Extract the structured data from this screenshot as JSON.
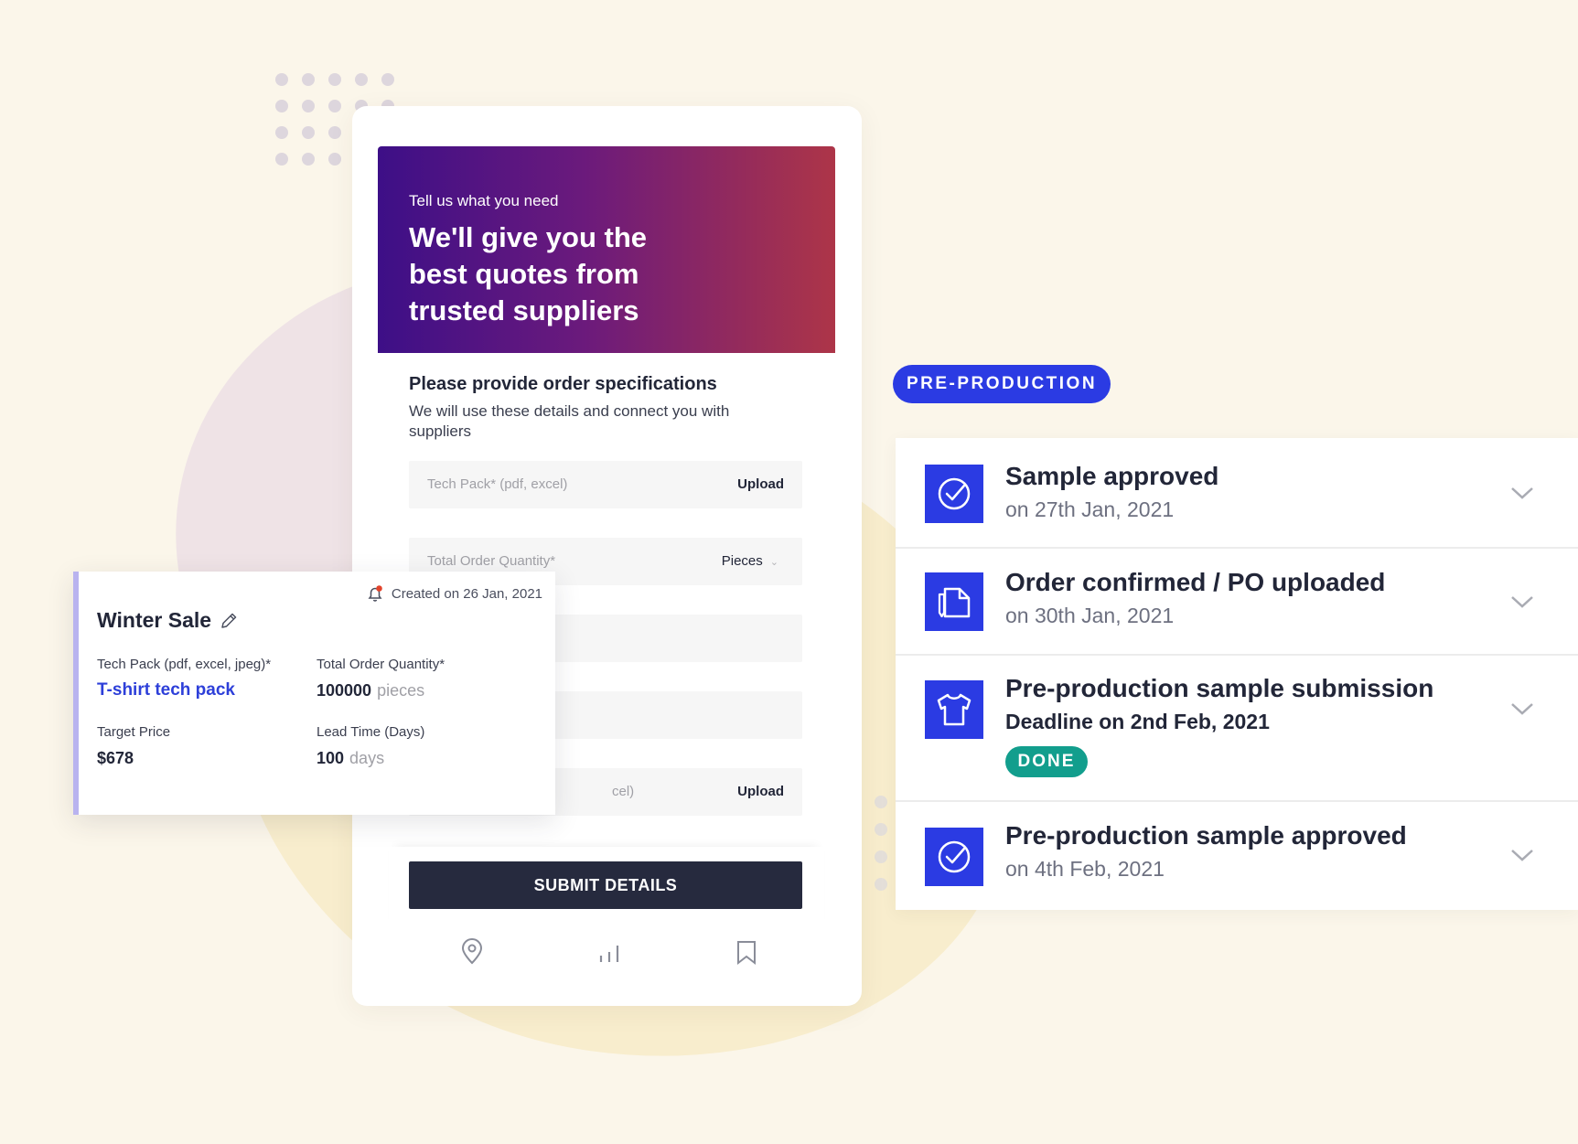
{
  "hero": {
    "kicker": "Tell us what you need",
    "title": "We'll give you the best quotes from trusted suppliers"
  },
  "form": {
    "heading": "Please provide order specifications",
    "subheading": "We will use these details and connect you with suppliers",
    "tech_pack_placeholder": "Tech Pack* (pdf, excel)",
    "upload_label": "Upload",
    "quantity_placeholder": "Total Order Quantity*",
    "quantity_unit": "Pieces",
    "partial_field_text": "cel)",
    "upload_label_2": "Upload",
    "submit_label": "SUBMIT DETAILS"
  },
  "bottom_nav": {
    "icons": [
      "location-pin-icon",
      "bar-chart-icon",
      "bookmark-icon"
    ]
  },
  "order_card": {
    "created": "Created on 26 Jan, 2021",
    "title": "Winter Sale",
    "tech_pack_label": "Tech Pack (pdf, excel, jpeg)*",
    "tech_pack_value": "T-shirt tech pack",
    "quantity_label": "Total Order Quantity*",
    "quantity_value": "100000",
    "quantity_unit": "pieces",
    "target_price_label": "Target Price",
    "target_price_value": "$678",
    "lead_time_label": "Lead Time (Days)",
    "lead_time_value": "100",
    "lead_time_unit": "days"
  },
  "timeline": {
    "stage_badge": "PRE-PRODUCTION",
    "steps": [
      {
        "title": "Sample approved",
        "date": "on 27th Jan, 2021",
        "icon": "check-circle-icon"
      },
      {
        "title": "Order confirmed / PO uploaded",
        "date": "on 30th Jan, 2021",
        "icon": "document-icon"
      },
      {
        "title": "Pre-production sample submission",
        "date": "Deadline on 2nd Feb, 2021",
        "status": "DONE",
        "icon": "tshirt-icon"
      },
      {
        "title": "Pre-production sample approved",
        "date": "on 4th Feb, 2021",
        "icon": "check-circle-icon"
      }
    ]
  },
  "colors": {
    "accent": "#2b3be3",
    "done": "#129e8d",
    "submit": "#262a3e",
    "link": "#2d3fd9",
    "gradient_start": "#3d0f87",
    "gradient_end": "#ad3548"
  }
}
